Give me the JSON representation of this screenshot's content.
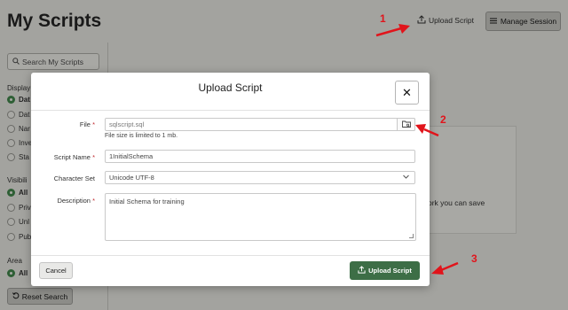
{
  "page": {
    "title": "My Scripts",
    "upload_link": "Upload Script",
    "manage_session": "Manage Session"
  },
  "sidebar": {
    "search_placeholder": "Search My Scripts",
    "display_label": "Display",
    "display_options": [
      "Dat",
      "Dat",
      "Nar",
      "Inve",
      "Sta"
    ],
    "visibility_label": "Visibili",
    "visibility_options": [
      "All",
      "Priv",
      "Unl",
      "Pub"
    ],
    "area_label": "Area",
    "area_options": [
      "All"
    ],
    "reset_button": "Reset Search"
  },
  "background_card_text": "ork you can save",
  "modal": {
    "title": "Upload Script",
    "close_icon": "close-icon",
    "file_label": "File",
    "file_value": "sqlscript.sql",
    "file_hint": "File size is limited to 1 mb.",
    "script_name_label": "Script Name",
    "script_name_value": "1InitialSchema",
    "character_set_label": "Character Set",
    "character_set_value": "Unicode UTF-8",
    "description_label": "Description",
    "description_value": "Initial Schema for training",
    "required_mark": "*",
    "cancel_button": "Cancel",
    "submit_button": "Upload Script"
  },
  "annotations": {
    "step1": "1",
    "step2": "2",
    "step3": "3"
  },
  "colors": {
    "primary_button": "#3d6e46",
    "annotation_red": "#e1141b",
    "required_red": "#c0272d"
  }
}
